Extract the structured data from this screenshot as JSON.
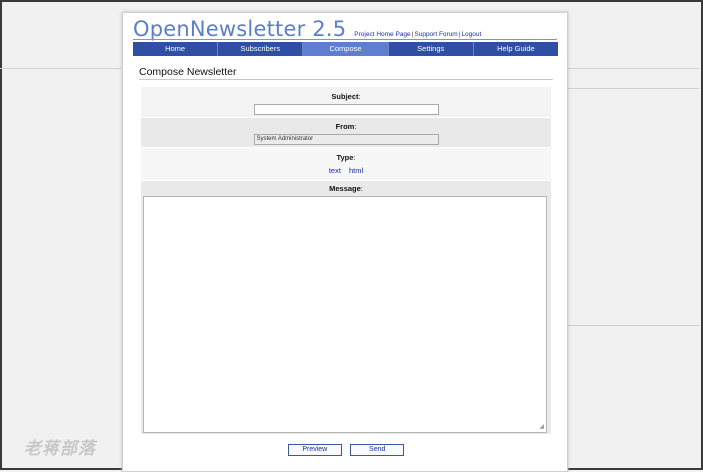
{
  "app": {
    "logo": "OpenNewsletter 2.5",
    "links": [
      "Project Home Page",
      "Support Forum",
      "Logout"
    ],
    "link_separator": "|"
  },
  "nav": [
    {
      "label": "Home"
    },
    {
      "label": "Subscribers"
    },
    {
      "label": "Compose",
      "active": true
    },
    {
      "label": "Settings"
    },
    {
      "label": "Help Guide"
    }
  ],
  "page": {
    "title": "Compose Newsletter"
  },
  "form": {
    "subject": {
      "label": "Subject",
      "value": ""
    },
    "from": {
      "label": "From",
      "value": "System Administrator"
    },
    "type": {
      "label": "Type",
      "options": [
        "text",
        "html"
      ]
    },
    "message": {
      "label": "Message",
      "value": ""
    },
    "colon": ":"
  },
  "buttons": {
    "preview": "Preview",
    "send": "Send"
  },
  "watermark": "老蒋部落",
  "colors": {
    "nav_bg": "#2e4fa4",
    "nav_active": "#5e7fd0",
    "link": "#1c2fa8",
    "logo": "#5a7fc8"
  }
}
